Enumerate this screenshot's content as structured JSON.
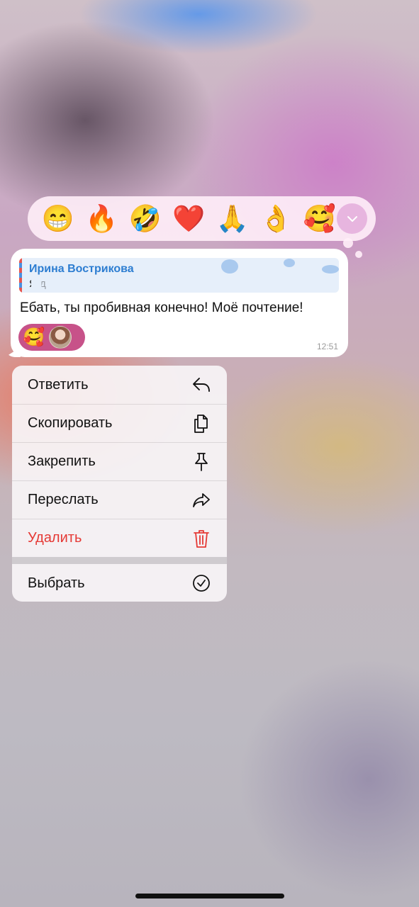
{
  "reactions": {
    "items": [
      "😁",
      "🔥",
      "🤣",
      "❤️",
      "🙏",
      "👌",
      "🥰"
    ],
    "expand_icon": "chevron-down-icon"
  },
  "message": {
    "reply": {
      "author": "Ирина Вострикова",
      "text": "Я до"
    },
    "text": "Ебать, ты пробивная конечно! Моё почтение!",
    "reaction": {
      "emoji": "🥰"
    },
    "time": "12:51"
  },
  "menu": {
    "items": [
      {
        "label": "Ответить",
        "icon": "reply-icon"
      },
      {
        "label": "Скопировать",
        "icon": "copy-icon"
      },
      {
        "label": "Закрепить",
        "icon": "pin-icon"
      },
      {
        "label": "Переслать",
        "icon": "forward-icon"
      },
      {
        "label": "Удалить",
        "icon": "trash-icon",
        "color": "#e53935"
      }
    ],
    "secondary": [
      {
        "label": "Выбрать",
        "icon": "check-circle-icon"
      }
    ]
  },
  "colors": {
    "quote_author": "#2c7dd1",
    "delete": "#e53935",
    "reaction_chip": "#c75289"
  }
}
